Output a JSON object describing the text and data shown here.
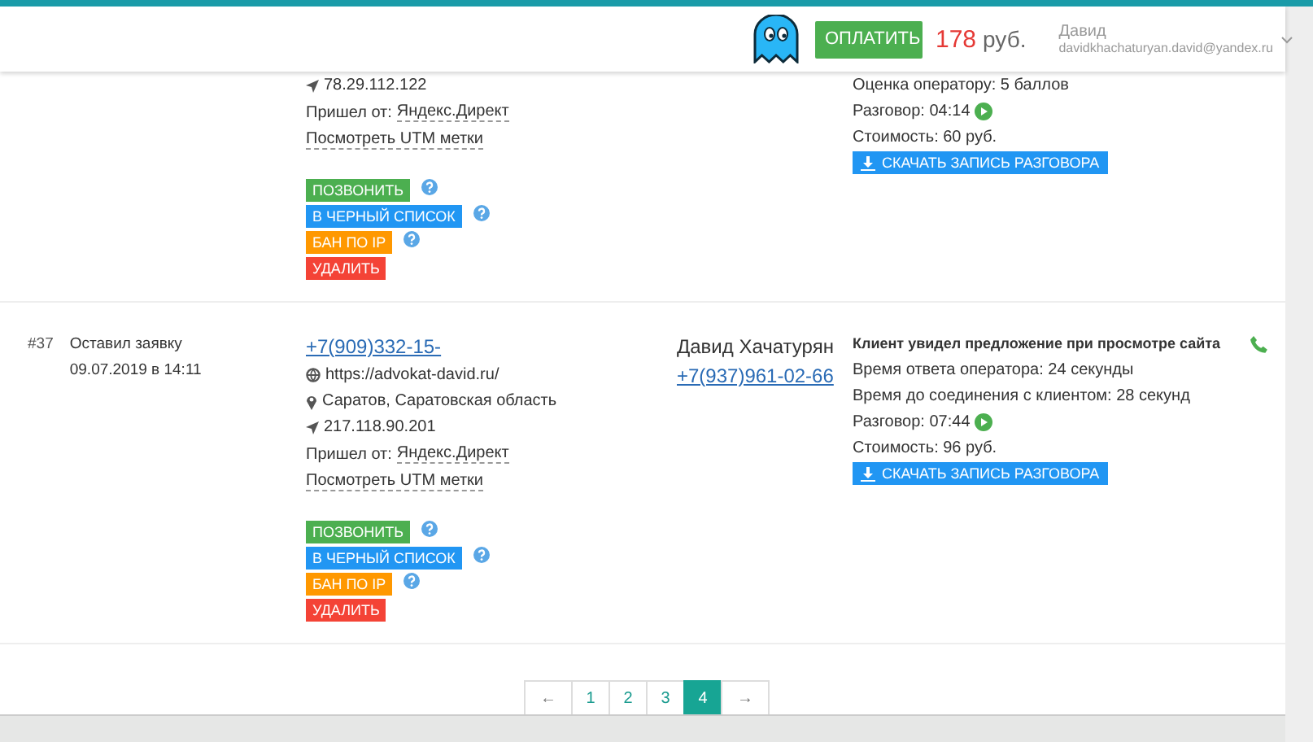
{
  "header": {
    "pay_button": "ОПЛАТИТЬ",
    "balance": "178",
    "currency": "руб.",
    "user_name": "Давид",
    "user_email": "davidkhachaturyan.david@yandex.ru"
  },
  "records": [
    {
      "ip": "78.29.112.122",
      "source_label": "Пришел от:",
      "source": "Яндекс.Директ",
      "utm": "Посмотреть UTM метки",
      "actions": [
        {
          "kind": "call",
          "label": "ПОЗВОНИТЬ",
          "help": true
        },
        {
          "kind": "blacklist",
          "label": "В ЧЕРНЫЙ СПИСОК",
          "help": true
        },
        {
          "kind": "ban",
          "label": "БАН ПО IP",
          "help": true
        },
        {
          "kind": "delete",
          "label": "УДАЛИТЬ",
          "help": false
        }
      ],
      "info": [
        {
          "kind": "text",
          "text": "Оценка оператору: 5 баллов"
        },
        {
          "kind": "talk",
          "text": "Разговор: 04:14"
        },
        {
          "kind": "text",
          "text": "Стоимость: 60 руб."
        }
      ],
      "download": "СКАЧАТЬ ЗАПИСЬ РАЗГОВОРА",
      "phone_icon": false
    },
    {
      "number": "#37",
      "event": "Оставил заявку",
      "date": "09.07.2019 в 14:11",
      "phone": "+7(909)332-15-",
      "site": "https://advokat-david.ru/",
      "city": "Саратов, Саратовская область",
      "ip": "217.118.90.201",
      "source_label": "Пришел от:",
      "source": "Яндекс.Директ",
      "utm": "Посмотреть UTM метки",
      "actions": [
        {
          "kind": "call",
          "label": "ПОЗВОНИТЬ",
          "help": true
        },
        {
          "kind": "blacklist",
          "label": "В ЧЕРНЫЙ СПИСОК",
          "help": true
        },
        {
          "kind": "ban",
          "label": "БАН ПО IP",
          "help": true
        },
        {
          "kind": "delete",
          "label": "УДАЛИТЬ",
          "help": false
        }
      ],
      "operator": "Давид Хачатурян",
      "operator_phone": "+7(937)961-02-66",
      "info": [
        {
          "kind": "title",
          "text": "Клиент увидел предложение при просмотре сайта"
        },
        {
          "kind": "text",
          "text": "Время ответа оператора: 24 секунды"
        },
        {
          "kind": "text",
          "text": "Время до соединения с клиентом: 28 секунд"
        },
        {
          "kind": "talk",
          "text": "Разговор: 07:44"
        },
        {
          "kind": "text",
          "text": "Стоимость: 96 руб."
        }
      ],
      "download": "СКАЧАТЬ ЗАПИСЬ РАЗГОВОРА",
      "phone_icon": true
    }
  ],
  "pagination": [
    {
      "label": "←",
      "selected": false
    },
    {
      "label": "1",
      "selected": false
    },
    {
      "label": "2",
      "selected": false
    },
    {
      "label": "3",
      "selected": false
    },
    {
      "label": "4",
      "selected": true
    },
    {
      "label": "→",
      "selected": false
    }
  ]
}
